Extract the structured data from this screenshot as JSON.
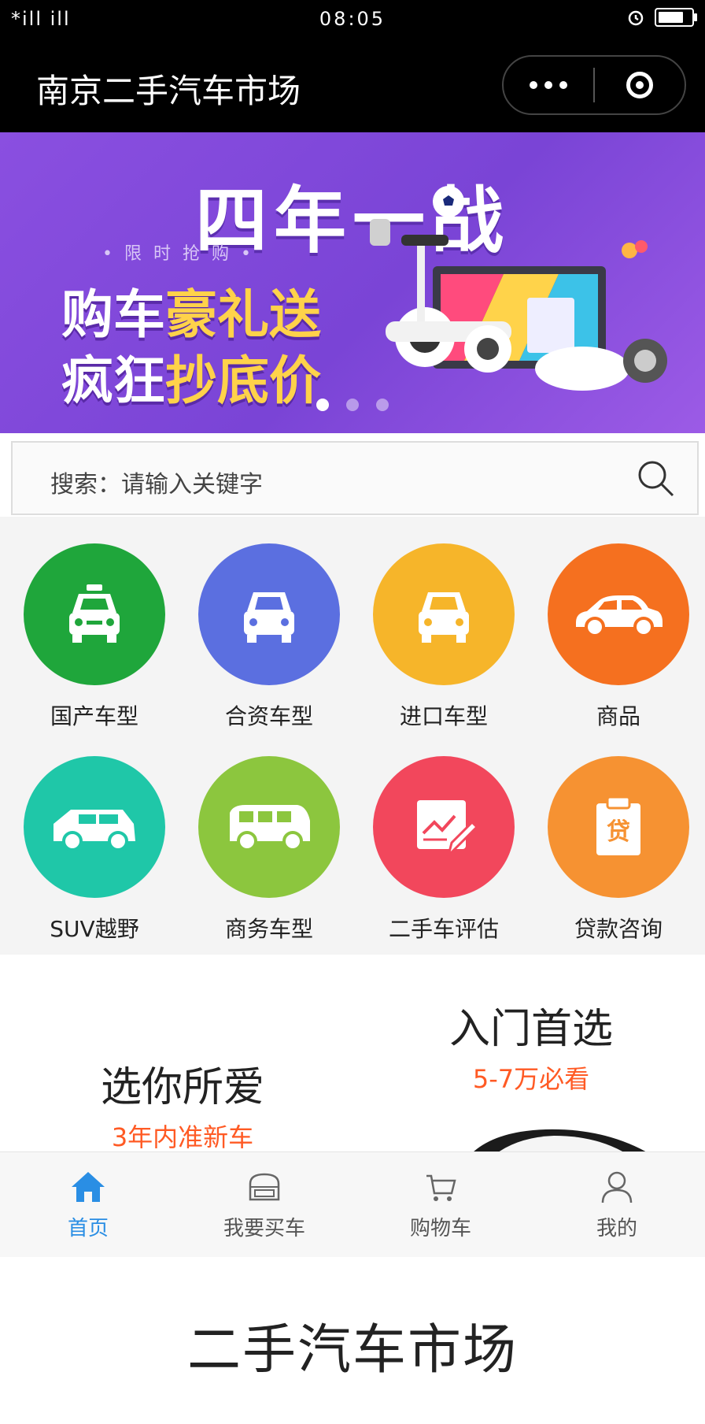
{
  "status_bar": {
    "signal": "*ill ill",
    "time": "08:05",
    "battery_level": 0.85
  },
  "header": {
    "title": "南京二手汽车市场"
  },
  "banner": {
    "title": "四年一战",
    "subtitle": "• 限 时 抢 购 •",
    "line1_white": "购车",
    "line1_gold": "豪礼送",
    "line2_white": "疯狂",
    "line2_gold": "抄底价",
    "slide_count": 3,
    "active_slide": 0
  },
  "search": {
    "placeholder": "搜索：请输入关键字"
  },
  "categories": [
    {
      "label": "国产车型",
      "icon": "taxi-icon",
      "color": "#1fa63b"
    },
    {
      "label": "合资车型",
      "icon": "car-front-icon",
      "color": "#5b6fe0"
    },
    {
      "label": "进口车型",
      "icon": "car-front-icon",
      "color": "#f6b52a"
    },
    {
      "label": "商品",
      "icon": "sedan-side-icon",
      "color": "#f5701f"
    },
    {
      "label": "SUV越野",
      "icon": "suv-icon",
      "color": "#1fc7a8"
    },
    {
      "label": "商务车型",
      "icon": "van-icon",
      "color": "#8cc63e"
    },
    {
      "label": "二手车评估",
      "icon": "chart-edit-icon",
      "color": "#f2475c"
    },
    {
      "label": "贷款咨询",
      "icon": "loan-clipboard-icon",
      "color": "#f69232"
    }
  ],
  "promos": [
    {
      "title": "选你所爱",
      "subtitle": "3年内准新车"
    },
    {
      "title": "入门首选",
      "subtitle": "5-7万必看"
    }
  ],
  "tabbar": [
    {
      "label": "首页",
      "icon": "home-icon",
      "active": true
    },
    {
      "label": "我要买车",
      "icon": "shop-icon",
      "active": false
    },
    {
      "label": "购物车",
      "icon": "cart-icon",
      "active": false
    },
    {
      "label": "我的",
      "icon": "user-icon",
      "active": false
    }
  ],
  "footer": {
    "text": "二手汽车市场"
  },
  "colors": {
    "banner": "#8a4fe0",
    "tab_active": "#2a8ee4",
    "promo_accent": "#ff5a24"
  }
}
